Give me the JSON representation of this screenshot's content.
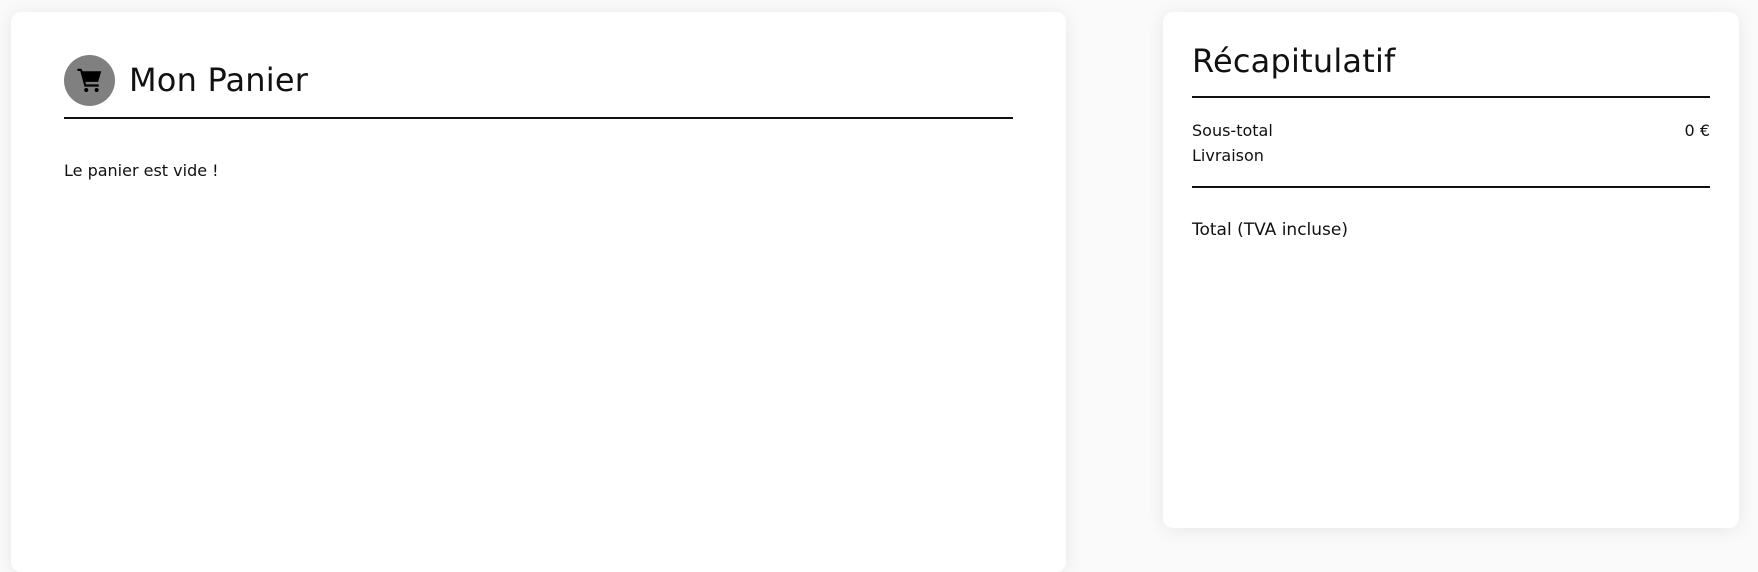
{
  "cart": {
    "title": "Mon Panier",
    "empty_message": "Le panier est vide !",
    "icon": "shopping-cart-icon",
    "icon_bg": "#808080"
  },
  "summary": {
    "title": "Récapitulatif",
    "subtotal_label": "Sous-total",
    "subtotal_value": "0 €",
    "shipping_label": "Livraison",
    "total_label": "Total (TVA incluse)"
  }
}
